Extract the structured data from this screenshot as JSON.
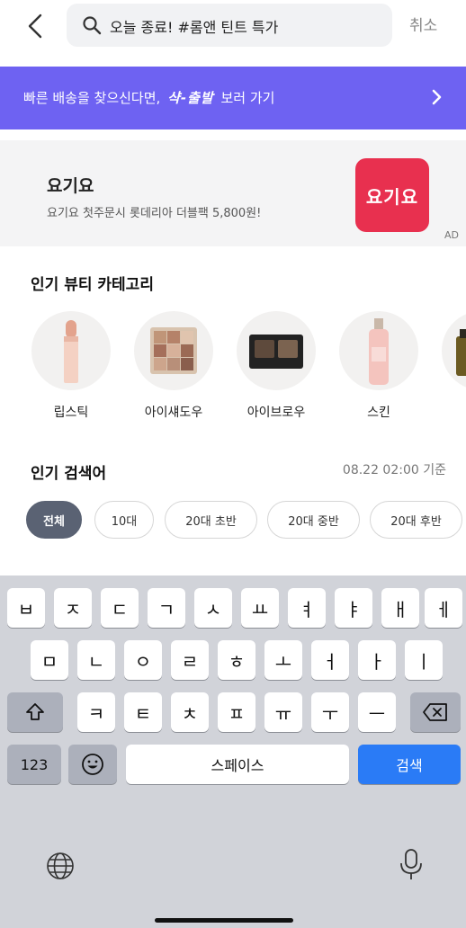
{
  "header": {
    "search_text": "오늘 종료! #롬앤 틴트 특가",
    "cancel_label": "취소"
  },
  "promo": {
    "prefix": "빠른 배송을 찾으신다면, ",
    "brand": "샥-출발",
    "suffix": " 보러 가기"
  },
  "ad": {
    "title": "요기요",
    "description": "요기요 첫주문시 롯데리아 더블팩 5,800원!",
    "logo_text": "요기요",
    "ad_label": "AD",
    "logo_color": "#e8304f"
  },
  "categories": {
    "title": "인기 뷰티 카테고리",
    "items": [
      {
        "label": "립스틱",
        "icon": "lipstick-icon"
      },
      {
        "label": "아이섀도우",
        "icon": "eyeshadow-palette-icon"
      },
      {
        "label": "아이브로우",
        "icon": "eyebrow-palette-icon"
      },
      {
        "label": "스킨",
        "icon": "skin-toner-icon"
      },
      {
        "label": "",
        "icon": "serum-bottle-icon"
      }
    ]
  },
  "popular": {
    "title": "인기 검색어",
    "time": "08.22 02:00 기준",
    "chips": [
      "전체",
      "10대",
      "20대 초반",
      "20대 중반",
      "20대 후반"
    ],
    "active_chip": "전체"
  },
  "keyboard": {
    "row1": [
      "ㅂ",
      "ㅈ",
      "ㄷ",
      "ㄱ",
      "ㅅ",
      "ㅛ",
      "ㅕ",
      "ㅑ",
      "ㅐ",
      "ㅔ"
    ],
    "row2": [
      "ㅁ",
      "ㄴ",
      "ㅇ",
      "ㄹ",
      "ㅎ",
      "ㅗ",
      "ㅓ",
      "ㅏ",
      "ㅣ"
    ],
    "row3": [
      "ㅋ",
      "ㅌ",
      "ㅊ",
      "ㅍ",
      "ㅠ",
      "ㅜ",
      "ㅡ"
    ],
    "numbers_label": "123",
    "space_label": "스페이스",
    "search_label": "검색",
    "accent_color": "#2a7bf6"
  },
  "colors": {
    "promo_bg": "#6e62f2",
    "active_chip_bg": "#5a6273"
  }
}
